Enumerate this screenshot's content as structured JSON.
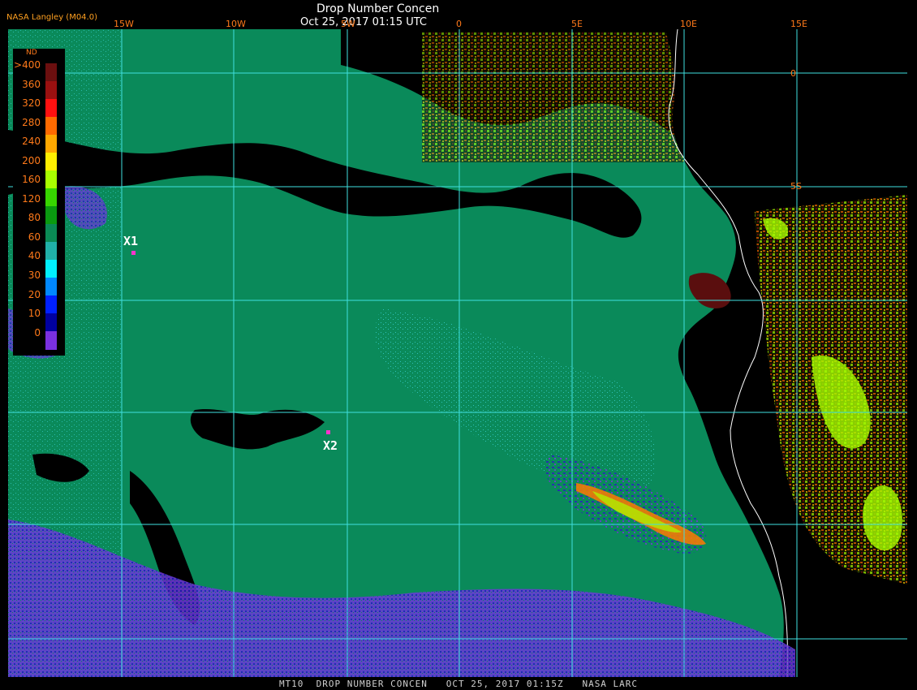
{
  "header": {
    "source": "NASA Langley (M04.0)",
    "title": "Drop Number Concen",
    "datetime": "Oct 25, 2017 01:15 UTC"
  },
  "footer": {
    "text": "MT10  DROP NUMBER CONCEN   OCT 25, 2017 01:15Z   NASA LARC"
  },
  "grid": {
    "lon_labels": [
      "15W",
      "10W",
      "5W",
      "0",
      "5E",
      "10E",
      "15E"
    ],
    "lat_labels": [
      "0",
      "5S"
    ]
  },
  "markers": [
    {
      "label": "X1",
      "color": "#ff33cc"
    },
    {
      "label": "X2",
      "color": "#ff33cc"
    }
  ],
  "legend": {
    "title": "ND",
    "labels": [
      ">400",
      "360",
      "320",
      "280",
      "240",
      "200",
      "160",
      "120",
      "80",
      "60",
      "40",
      "30",
      "20",
      "10",
      "0"
    ],
    "colors": [
      "#6b0f0f",
      "#9a1010",
      "#ff1010",
      "#ff6a00",
      "#ffa800",
      "#ffee00",
      "#a8ff00",
      "#37d600",
      "#0a9a10",
      "#0a8a55",
      "#20b0a8",
      "#00f0ff",
      "#0088ff",
      "#0020ff",
      "#0000a0",
      "#7a30e0"
    ]
  },
  "colors": {
    "ocean": "#0a8a5a",
    "land": "#000000",
    "grid_lines": "#40e0e0",
    "coast": "#ffffff"
  }
}
